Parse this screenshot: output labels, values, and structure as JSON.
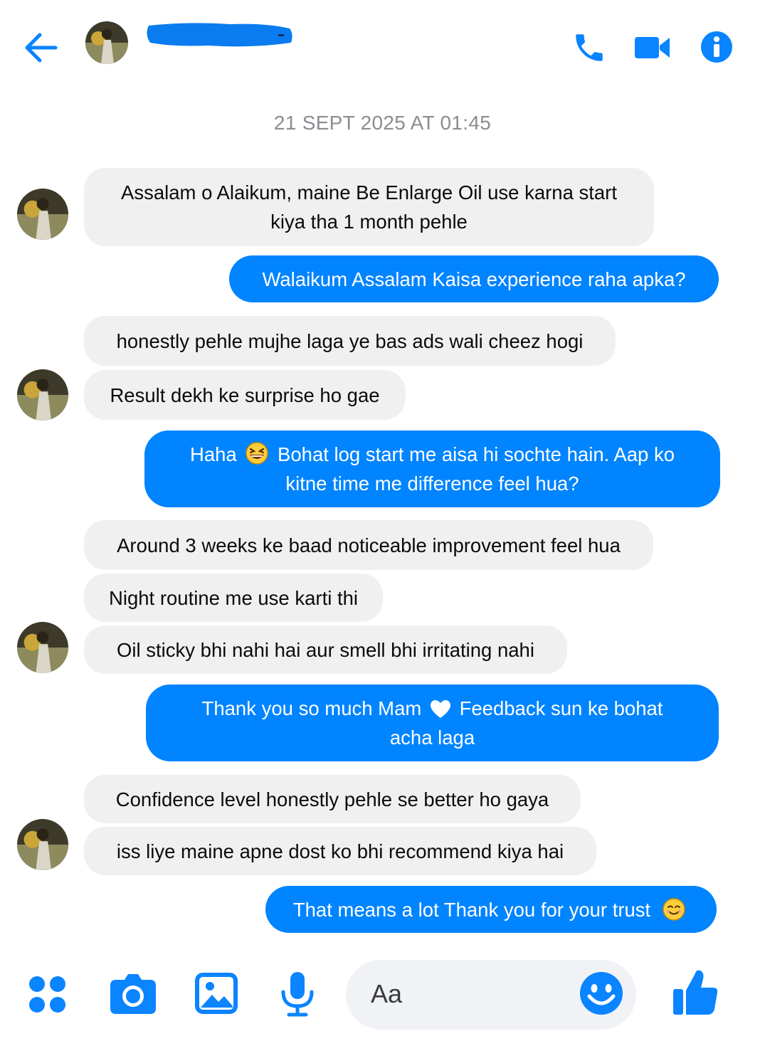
{
  "header": {
    "back_icon": "arrow-left-icon",
    "contact_avatar": "avatar",
    "contact_name": "",
    "actions": [
      "phone-icon",
      "video-camera-icon",
      "info-icon"
    ],
    "accent_color": "#0084ff"
  },
  "conversation": {
    "timestamp": "21 SEPT 2025 AT 01:45",
    "messages": [
      {
        "from": "them",
        "line1": "Assalam o Alaikum, maine Be Enlarge Oil use karna start",
        "line2": "kiya tha 1 month pehle"
      },
      {
        "from": "me",
        "text": "Walaikum Assalam Kaisa experience raha apka?"
      },
      {
        "from": "them",
        "text": "honestly pehle mujhe laga ye bas ads wali cheez hogi"
      },
      {
        "from": "them",
        "text": "Result dekh ke surprise ho gae"
      },
      {
        "from": "me",
        "part1": "Haha",
        "emoji": "grinning-squinting-face",
        "part2": "Bohat log start me aisa hi sochte hain. Aap ko",
        "line2": "kitne time me difference feel hua?"
      },
      {
        "from": "them",
        "text": "Around 3 weeks ke baad noticeable improvement feel hua"
      },
      {
        "from": "them",
        "text": "Night routine me use karti thi"
      },
      {
        "from": "them",
        "text": "Oil sticky bhi nahi hai aur smell bhi irritating nahi"
      },
      {
        "from": "me",
        "part1": "Thank you so much Mam",
        "emoji": "white-heart",
        "part2": "Feedback sun ke bohat",
        "line2": "acha laga"
      },
      {
        "from": "them",
        "text": "Confidence level honestly pehle se better ho gaya"
      },
      {
        "from": "them",
        "text": "iss liye maine apne dost ko bhi recommend kiya hai"
      },
      {
        "from": "me",
        "text": "That means a lot Thank you for your trust",
        "emoji": "smiling-face"
      }
    ]
  },
  "composer": {
    "tools": [
      "apps-grid-icon",
      "camera-icon",
      "gallery-icon",
      "microphone-icon"
    ],
    "placeholder": "Aa",
    "emoji_icon": "smiley-icon",
    "send_icon": "thumbs-up-icon"
  }
}
